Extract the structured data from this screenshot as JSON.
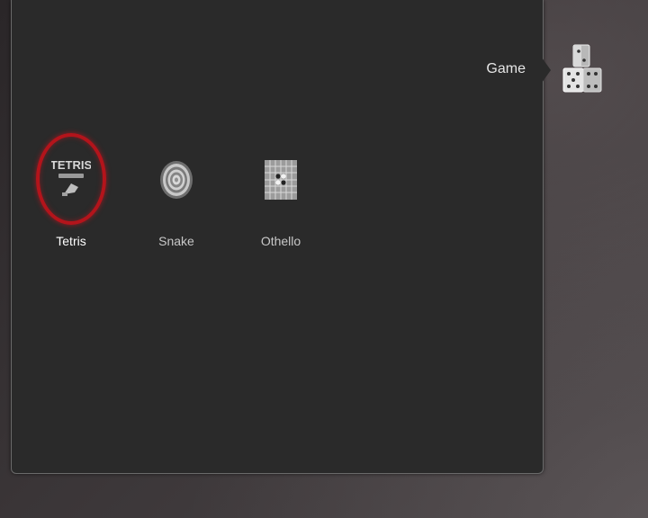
{
  "header": {
    "menu_title": "Game",
    "icon": "dice-icon"
  },
  "items": [
    {
      "label": "Tetris",
      "icon": "tetris-icon",
      "logo_text": "TETRIS",
      "selected": true
    },
    {
      "label": "Snake",
      "icon": "snake-spiral-icon",
      "selected": false
    },
    {
      "label": "Othello",
      "icon": "othello-board-icon",
      "selected": false
    }
  ],
  "colors": {
    "panel": "#2a2a2a",
    "focus": "#b3141b",
    "text": "#e6e6e6"
  }
}
